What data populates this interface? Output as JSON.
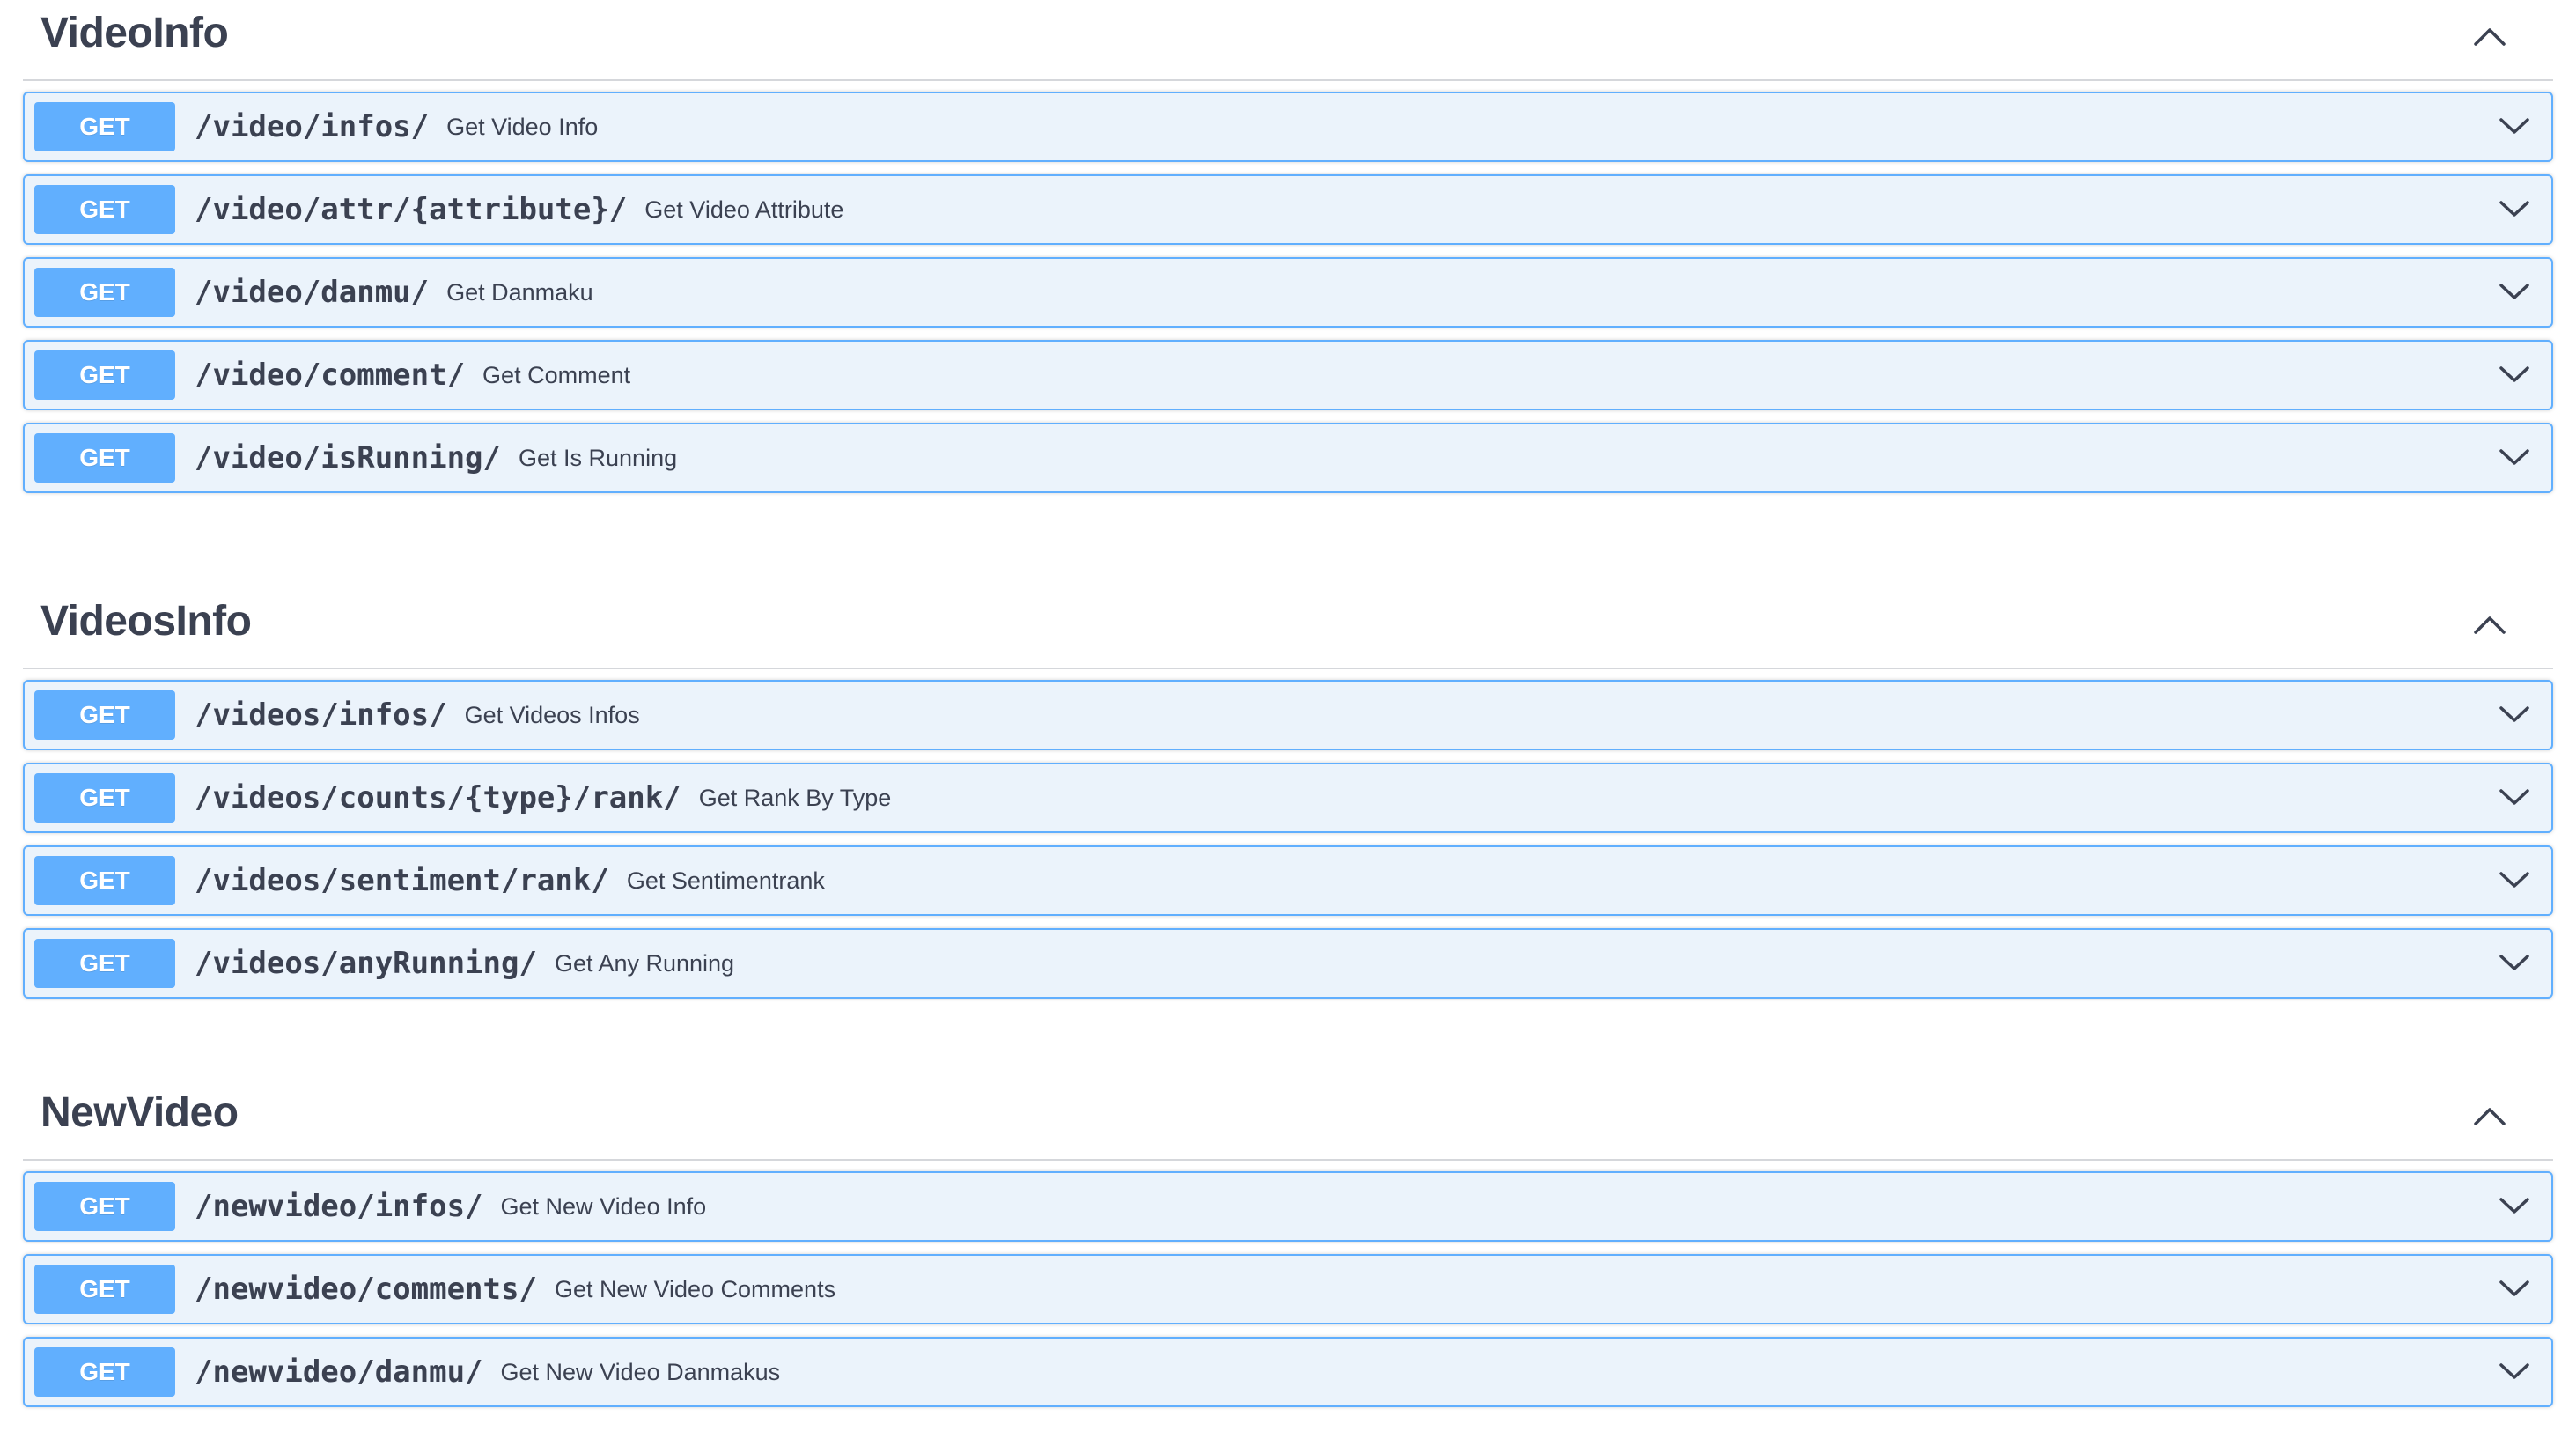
{
  "method_color": "#61affe",
  "sections": [
    {
      "title": "VideoInfo",
      "toggle_icon": "chevron-up-icon",
      "operations": [
        {
          "method": "GET",
          "path": "/video/infos/",
          "summary": "Get Video Info"
        },
        {
          "method": "GET",
          "path": "/video/attr/{attribute}/",
          "summary": "Get Video Attribute"
        },
        {
          "method": "GET",
          "path": "/video/danmu/",
          "summary": "Get Danmaku"
        },
        {
          "method": "GET",
          "path": "/video/comment/",
          "summary": "Get Comment"
        },
        {
          "method": "GET",
          "path": "/video/isRunning/",
          "summary": "Get Is Running"
        }
      ]
    },
    {
      "title": "VideosInfo",
      "toggle_icon": "chevron-up-icon",
      "operations": [
        {
          "method": "GET",
          "path": "/videos/infos/",
          "summary": "Get Videos Infos"
        },
        {
          "method": "GET",
          "path": "/videos/counts/{type}/rank/",
          "summary": "Get Rank By Type"
        },
        {
          "method": "GET",
          "path": "/videos/sentiment/rank/",
          "summary": "Get Sentimentrank"
        },
        {
          "method": "GET",
          "path": "/videos/anyRunning/",
          "summary": "Get Any Running"
        }
      ]
    },
    {
      "title": "NewVideo",
      "toggle_icon": "chevron-up-icon",
      "operations": [
        {
          "method": "GET",
          "path": "/newvideo/infos/",
          "summary": "Get New Video Info"
        },
        {
          "method": "GET",
          "path": "/newvideo/comments/",
          "summary": "Get New Video Comments"
        },
        {
          "method": "GET",
          "path": "/newvideo/danmu/",
          "summary": "Get New Video Danmakus"
        }
      ]
    }
  ]
}
